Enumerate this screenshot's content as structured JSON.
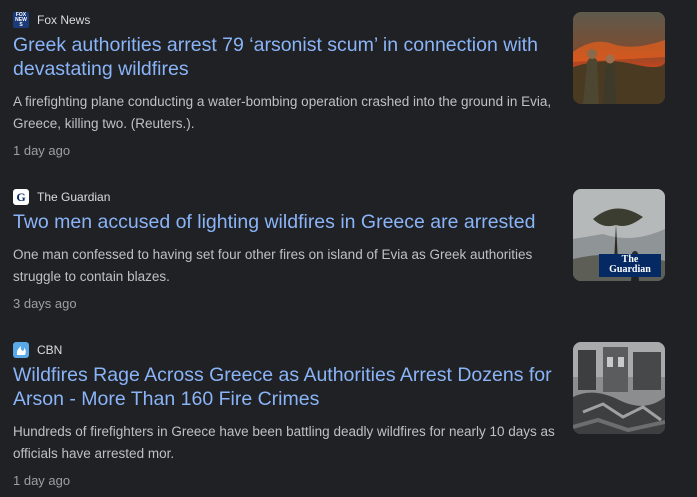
{
  "articles": [
    {
      "source": "Fox News",
      "logo_text": "FOX NEWS",
      "headline": "Greek authorities arrest 79 ‘arsonist scum’ in connection with devastating wildfires",
      "snippet": "A firefighting plane conducting a water-bombing operation crashed into the ground in Evia, Greece, killing two. (Reuters.).",
      "time": "1 day ago",
      "thumbnail": "men-watching-wildfire-image"
    },
    {
      "source": "The Guardian",
      "logo_text": "G",
      "headline": "Two men accused of lighting wildfires in Greece are arrested",
      "snippet": "One man confessed to having set four other fires on island of Evia as Greek authorities struggle to contain blazes.",
      "time": "3 days ago",
      "thumbnail": "firefighter-in-smoke-image",
      "thumbnail_badge": [
        "The",
        "Guardian"
      ]
    },
    {
      "source": "CBN",
      "headline": "Wildfires Rage Across Greece as Authorities Arrest Dozens for Arson - More Than 160 Fire Crimes",
      "snippet": "Hundreds of firefighters in Greece have been battling deadly wildfires for nearly 10 days as officials have arrested mor.",
      "time": "1 day ago",
      "thumbnail": "burned-building-image"
    }
  ],
  "colors": {
    "background": "#202124",
    "headline": "#8ab4f8",
    "snippet": "#bdc1c6",
    "time": "#9aa0a6",
    "source": "#dadce0"
  }
}
